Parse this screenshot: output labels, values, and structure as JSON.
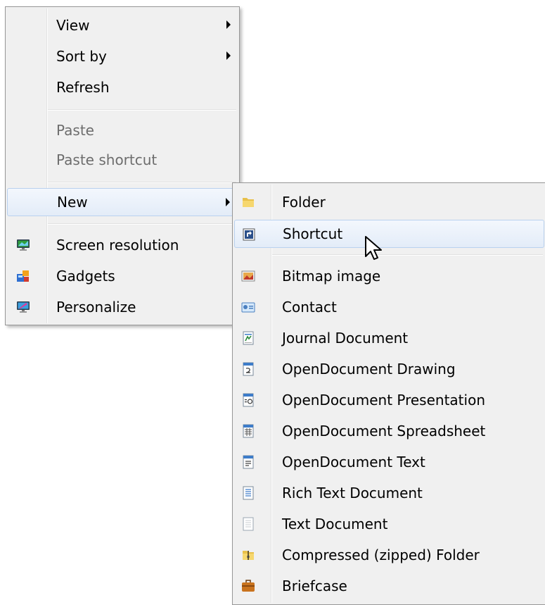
{
  "context_menu": {
    "items": [
      {
        "label": "View",
        "has_submenu": true,
        "enabled": true
      },
      {
        "label": "Sort by",
        "has_submenu": true,
        "enabled": true
      },
      {
        "label": "Refresh",
        "enabled": true
      },
      {
        "label": "Paste",
        "enabled": false
      },
      {
        "label": "Paste shortcut",
        "enabled": false
      },
      {
        "label": "New",
        "has_submenu": true,
        "enabled": true,
        "highlighted": true
      },
      {
        "label": "Screen resolution",
        "icon": "monitor-icon",
        "enabled": true
      },
      {
        "label": "Gadgets",
        "icon": "gadgets-icon",
        "enabled": true
      },
      {
        "label": "Personalize",
        "icon": "personalize-icon",
        "enabled": true
      }
    ]
  },
  "new_submenu": {
    "items": [
      {
        "label": "Folder",
        "icon": "folder-icon"
      },
      {
        "label": "Shortcut",
        "icon": "shortcut-icon",
        "highlighted": true
      },
      {
        "label": "Bitmap image",
        "icon": "bitmap-icon"
      },
      {
        "label": "Contact",
        "icon": "contact-icon"
      },
      {
        "label": "Journal Document",
        "icon": "journal-icon"
      },
      {
        "label": "OpenDocument Drawing",
        "icon": "odg-icon"
      },
      {
        "label": "OpenDocument Presentation",
        "icon": "odp-icon"
      },
      {
        "label": "OpenDocument Spreadsheet",
        "icon": "ods-icon"
      },
      {
        "label": "OpenDocument Text",
        "icon": "odt-icon"
      },
      {
        "label": "Rich Text Document",
        "icon": "rtf-icon"
      },
      {
        "label": "Text Document",
        "icon": "txt-icon"
      },
      {
        "label": "Compressed (zipped) Folder",
        "icon": "zip-folder-icon"
      },
      {
        "label": "Briefcase",
        "icon": "briefcase-icon"
      }
    ]
  },
  "colors": {
    "menu_bg": "#f0f0f0",
    "menu_border": "#979797",
    "highlight_border": "#b9d1ef",
    "disabled_text": "#6d6d6d"
  }
}
